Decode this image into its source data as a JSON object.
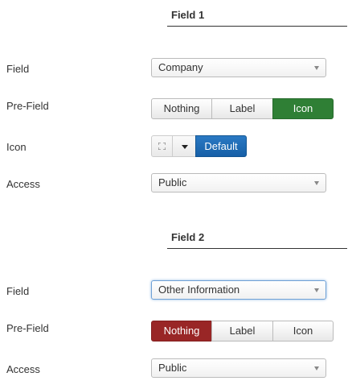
{
  "field1": {
    "title": "Field 1",
    "field_label": "Field",
    "field_value": "Company",
    "prefield_label": "Pre-Field",
    "prefield_options": [
      "Nothing",
      "Label",
      "Icon"
    ],
    "prefield_selected": "Icon",
    "icon_label": "Icon",
    "icon_default_button": "Default",
    "access_label": "Access",
    "access_value": "Public"
  },
  "field2": {
    "title": "Field 2",
    "field_label": "Field",
    "field_value": "Other Information",
    "prefield_label": "Pre-Field",
    "prefield_options": [
      "Nothing",
      "Label",
      "Icon"
    ],
    "prefield_selected": "Nothing",
    "access_label": "Access",
    "access_value": "Public"
  },
  "colors": {
    "selected_green": "#2f7f35",
    "selected_red": "#992626",
    "default_blue": "#1f6db8"
  }
}
